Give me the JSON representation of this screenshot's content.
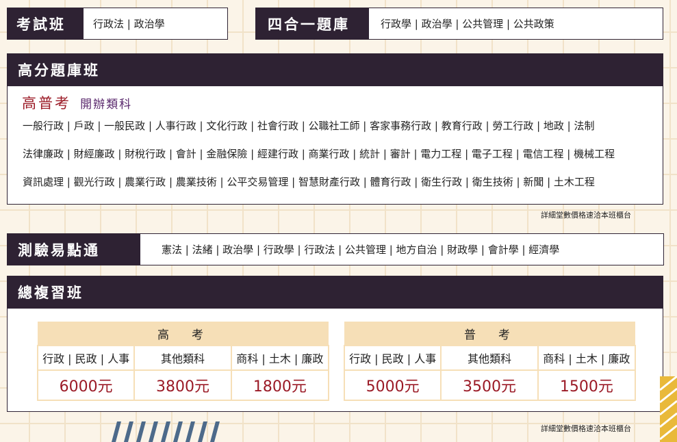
{
  "top": {
    "exam_class": {
      "label": "考試班",
      "subjects": "行政法 | 政治學"
    },
    "four_in_one": {
      "label": "四合一題庫",
      "subjects": "行政學 | 政治學 | 公共管理 | 公共政策"
    }
  },
  "high_score": {
    "title": "高分題庫班",
    "exam_name": "高普考",
    "exam_subtitle": "開辦類科",
    "lines": [
      "一般行政 | 戶政 | 一般民政 | 人事行政 | 文化行政 | 社會行政 | 公職社工師 | 客家事務行政 | 教育行政 | 勞工行政 | 地政 | 法制",
      "法律廉政 | 財經廉政 | 財稅行政 | 會計 | 金融保險 | 經建行政 | 商業行政 | 統計 | 審計 | 電力工程 | 電子工程 | 電信工程 | 機械工程",
      "資訊處理 | 觀光行政 | 農業行政 | 農業技術 | 公平交易管理 | 智慧財產行政 | 體育行政 | 衛生行政 | 衛生技術 | 新聞 | 土木工程"
    ],
    "note": "詳細堂數價格速洽本班櫃台"
  },
  "quiz": {
    "label": "測驗易點通",
    "subjects": "憲法 | 法緒 | 政治學 | 行政學 | 行政法 | 公共管理 | 地方自治 | 財政學 | 會計學 | 經濟學"
  },
  "review": {
    "title": "總複習班",
    "high": {
      "name": "高　考",
      "cols": [
        "行政 | 民政 | 人事",
        "其他類科",
        "商科 | 土木 | 廉政"
      ],
      "prices": [
        "6000元",
        "3800元",
        "1800元"
      ]
    },
    "general": {
      "name": "普　考",
      "cols": [
        "行政 | 民政 | 人事",
        "其他類科",
        "商科 | 土木 | 廉政"
      ],
      "prices": [
        "5000元",
        "3500元",
        "1500元"
      ]
    },
    "note": "詳細堂數價格速洽本班櫃台"
  },
  "colors": {
    "dark": "#2e2233",
    "accent_red": "#9b1a26",
    "tan": "#f6dfb7",
    "purple": "#5b2a6e"
  }
}
